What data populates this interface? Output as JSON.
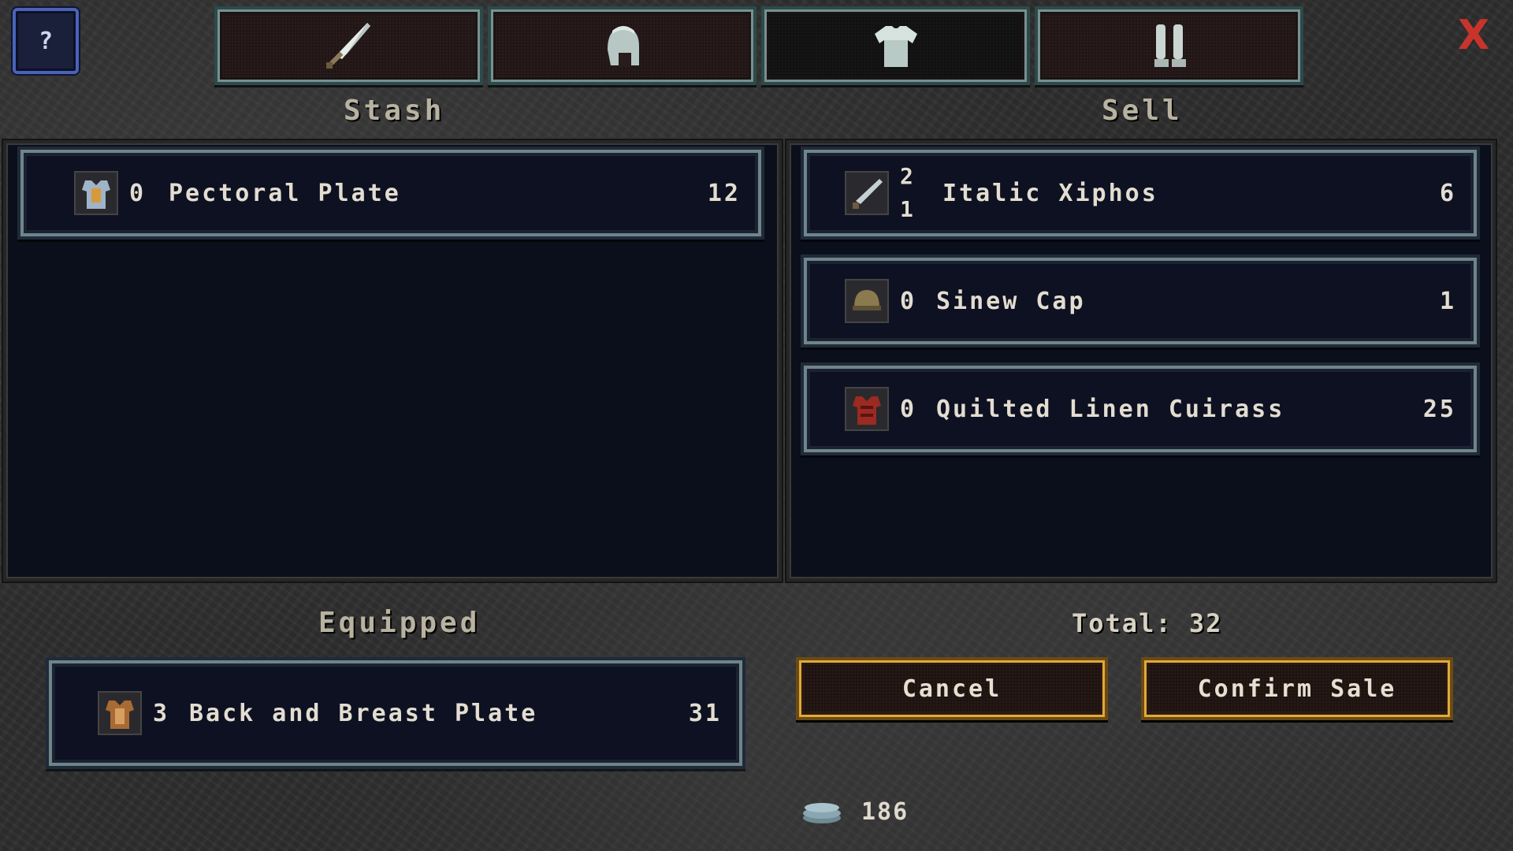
{
  "help": {
    "label": "?"
  },
  "close": {
    "label": "X"
  },
  "tabs": [
    {
      "name": "weapons",
      "icon": "sword-icon"
    },
    {
      "name": "helmets",
      "icon": "helmet-icon"
    },
    {
      "name": "armor",
      "icon": "tunic-icon",
      "active": true
    },
    {
      "name": "legs",
      "icon": "greaves-icon"
    }
  ],
  "stash": {
    "heading": "Stash",
    "items": [
      {
        "icon": "plate-armor-icon",
        "qty": "0",
        "name": "Pectoral Plate",
        "price": "12"
      }
    ]
  },
  "sell": {
    "heading": "Sell",
    "items": [
      {
        "icon": "sword-icon",
        "qty_top": "2",
        "qty_bottom": "1",
        "name": "Italic Xiphos",
        "price": "6"
      },
      {
        "icon": "cap-icon",
        "qty": "0",
        "name": "Sinew Cap",
        "price": "1"
      },
      {
        "icon": "cuirass-icon",
        "qty": "0",
        "name": "Quilted Linen Cuirass",
        "price": "25"
      }
    ]
  },
  "equipped": {
    "heading": "Equipped",
    "item": {
      "icon": "breastplate-icon",
      "qty": "3",
      "name": "Back and Breast Plate",
      "price": "31"
    }
  },
  "total": {
    "text": "Total: 32"
  },
  "buttons": {
    "cancel": "Cancel",
    "confirm": "Confirm Sale"
  },
  "currency": {
    "icon": "coin-stack-icon",
    "amount": "186"
  },
  "colors": {
    "accent_gold": "#e0a93a",
    "row_border": "#6f8588",
    "close_red": "#c8342c",
    "help_blue": "#4a63b8"
  }
}
